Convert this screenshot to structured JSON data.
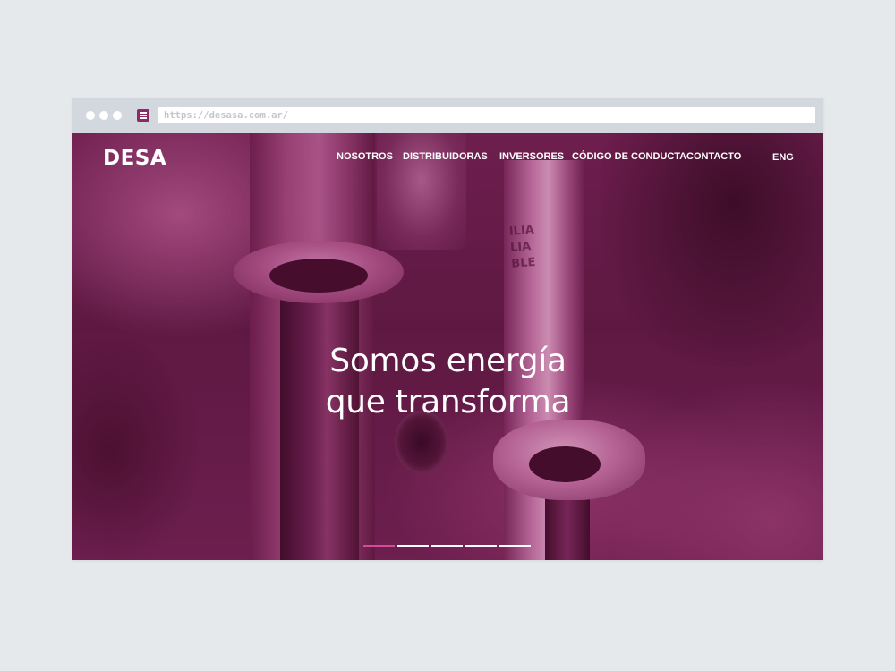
{
  "browser": {
    "url": "https://desasa.com.ar/"
  },
  "header": {
    "logo": "DESA",
    "nav": [
      "NOSOTROS",
      "DISTRIBUIDORAS",
      "INVERSORES",
      "CÓDIGO DE CONDUCTA",
      "CONTACTO"
    ],
    "language": "ENG"
  },
  "hero": {
    "headline_line1": "Somos energía",
    "headline_line2": "que transforma",
    "image_text": [
      "ILIA",
      "LIA",
      "BLE"
    ],
    "slides": {
      "count": 5,
      "active_index": 0
    },
    "tint_color": "#6e1848",
    "indicator_active_color": "#d64a9a"
  }
}
